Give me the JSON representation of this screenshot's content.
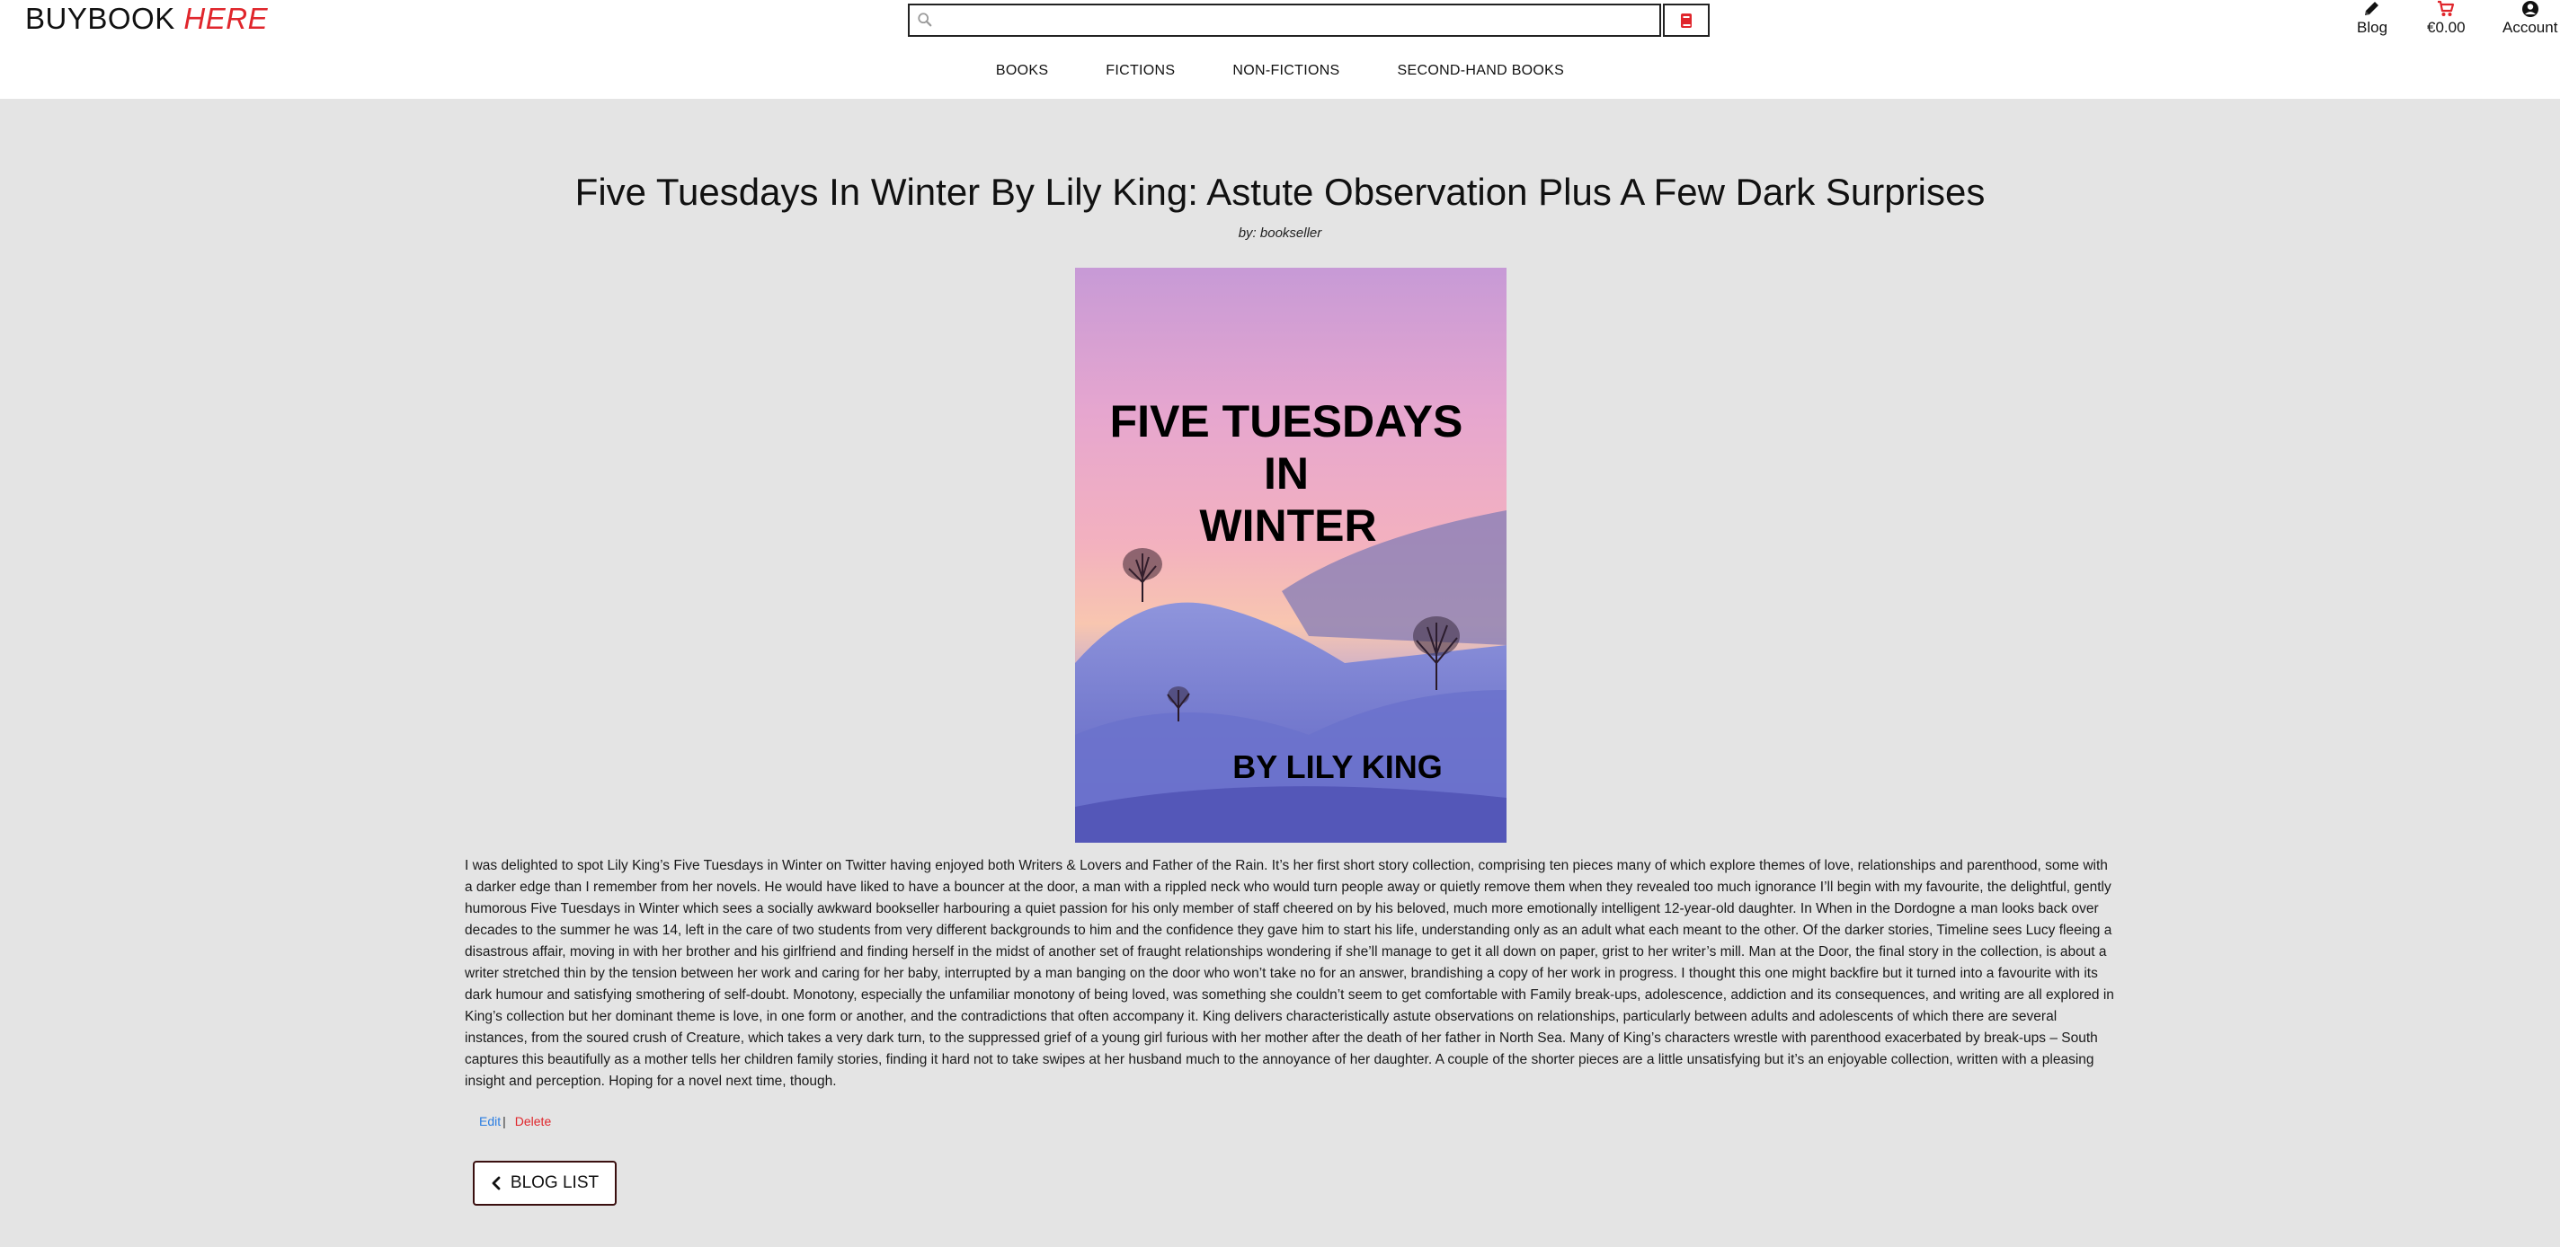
{
  "header": {
    "logo_main": "BUYBOOK",
    "logo_accent": "HERE",
    "search_placeholder": "",
    "blog_label": "Blog",
    "cart_total": "€0.00",
    "account_label": "Account"
  },
  "nav": {
    "items": [
      "BOOKS",
      "FICTIONS",
      "NON-FICTIONS",
      "SECOND-HAND BOOKS"
    ]
  },
  "post": {
    "title": "Five Tuesdays In Winter By Lily King: Astute Observation Plus A Few Dark Surprises",
    "byline": "by: bookseller",
    "cover": {
      "title_line1": "FIVE TUESDAYS",
      "title_line2": "IN",
      "title_line3": "WINTER",
      "author": "BY LILY KING"
    },
    "body": "I was delighted to spot Lily King’s Five Tuesdays in Winter on Twitter having enjoyed both Writers & Lovers and Father of the Rain. It’s her first short story collection, comprising ten pieces many of which explore themes of love, relationships and parenthood, some with a darker edge than I remember from her novels. He would have liked to have a bouncer at the door, a man with a rippled neck who would turn people away or quietly remove them when they revealed too much ignorance I’ll begin with my favourite, the delightful, gently humorous Five Tuesdays in Winter which sees a socially awkward bookseller harbouring a quiet passion for his only member of staff cheered on by his beloved, much more emotionally intelligent 12-year-old daughter. In When in the Dordogne a man looks back over decades to the summer he was 14, left in the care of two students from very different backgrounds to him and the confidence they gave him to start his life, understanding only as an adult what each meant to the other. Of the darker stories, Timeline sees Lucy fleeing a disastrous affair, moving in with her brother and his girlfriend and finding herself in the midst of another set of fraught relationships wondering if she’ll manage to get it all down on paper, grist to her writer’s mill. Man at the Door, the final story in the collection, is about a writer stretched thin by the tension between her work and caring for her baby, interrupted by a man banging on the door who won’t take no for an answer, brandishing a copy of her work in progress. I thought this one might backfire but it turned into a favourite with its dark humour and satisfying smothering of self-doubt. Monotony, especially the unfamiliar monotony of being loved, was something she couldn’t seem to get comfortable with Family break-ups, adolescence, addiction and its consequences, and writing are all explored in King’s collection but her dominant theme is love, in one form or another, and the contradictions that often accompany it. King delivers characteristically astute observations on relationships, particularly between adults and adolescents of which there are several instances, from the soured crush of Creature, which takes a very dark turn, to the suppressed grief of a young girl furious with her mother after the death of her father in North Sea. Many of King’s characters wrestle with parenthood exacerbated by break-ups – South captures this beautifully as a mother tells her children family stories, finding it hard not to take swipes at her husband much to the annoyance of her daughter. A couple of the shorter pieces are a little unsatisfying but it’s an enjoyable collection, written with a pleasing insight and perception. Hoping for a novel next time, though.",
    "edit_label": "Edit",
    "separator": "|",
    "delete_label": "Delete",
    "back_label": "BLOG LIST"
  },
  "colors": {
    "accent": "#e0262c",
    "edit_link": "#2a7de1",
    "page_bg": "#e4e4e4"
  },
  "icons": [
    "search-icon",
    "book-icon",
    "pencil-icon",
    "cart-icon",
    "user-icon",
    "chevron-left-icon"
  ]
}
